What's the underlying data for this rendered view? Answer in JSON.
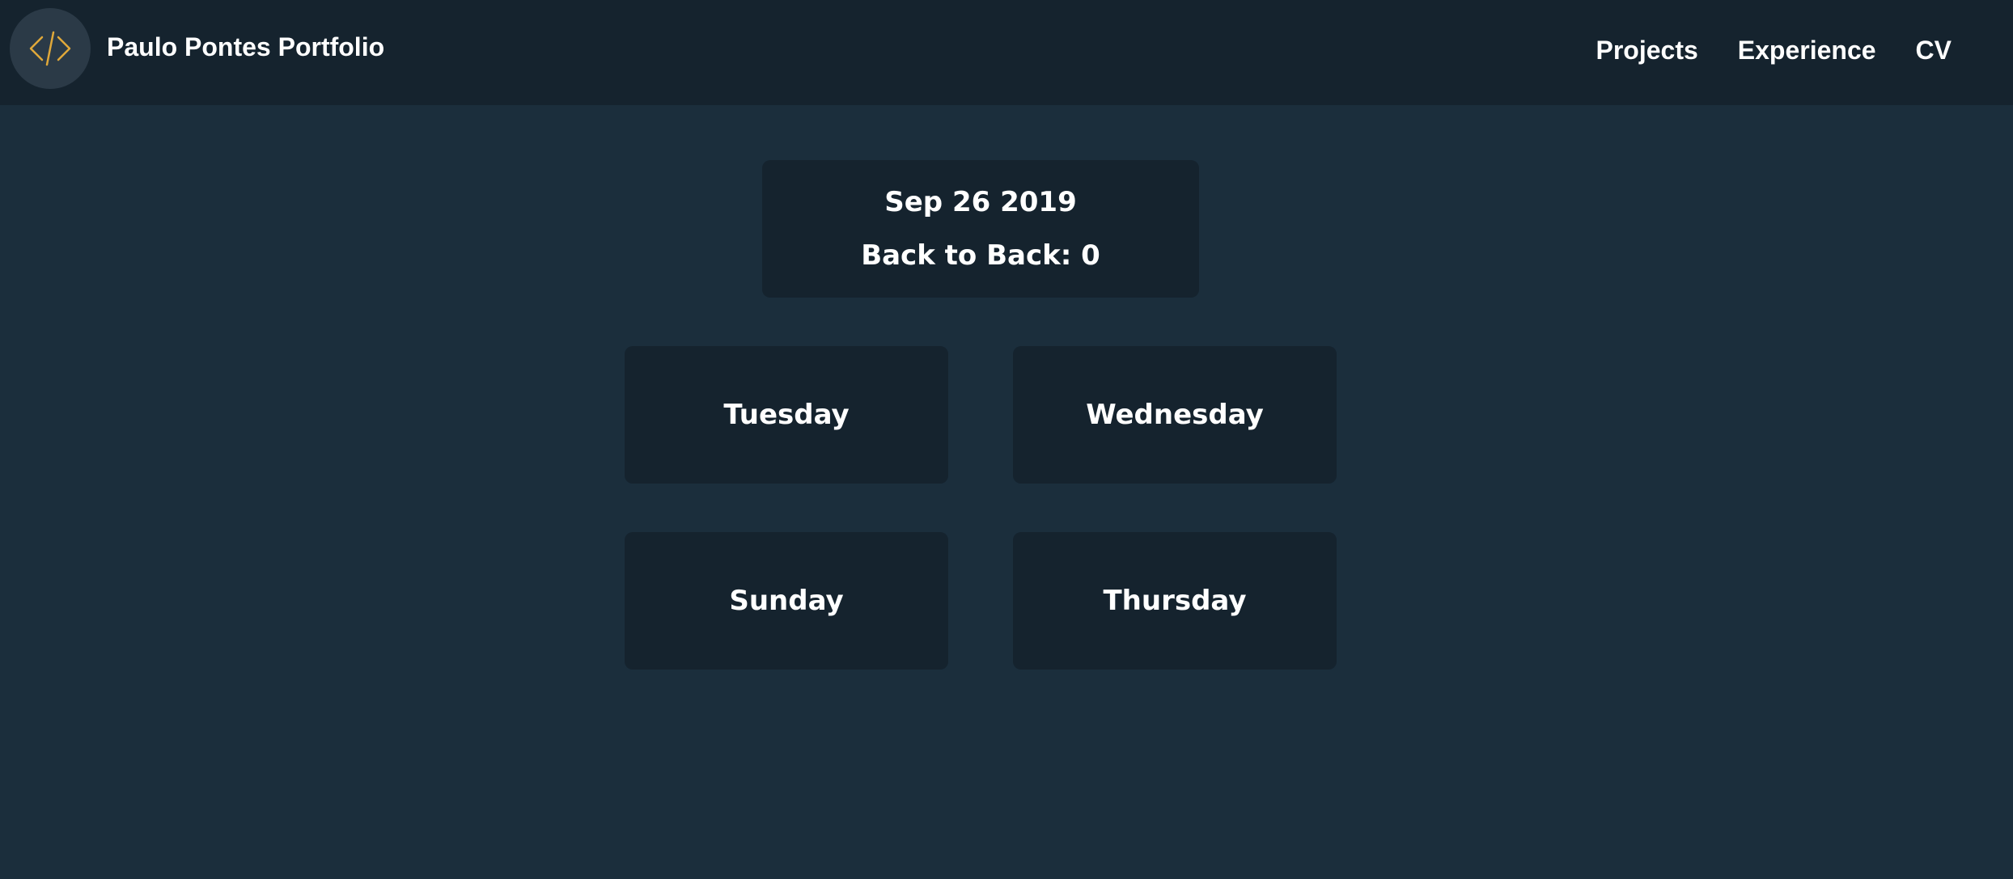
{
  "header": {
    "brand": "Paulo Pontes Portfolio",
    "logo_icon": "code-icon",
    "logo_color": "#e0a83a",
    "nav": [
      {
        "label": "Projects"
      },
      {
        "label": "Experience"
      },
      {
        "label": "CV"
      }
    ]
  },
  "info": {
    "date": "Sep 26 2019",
    "back_to_back": "Back to Back: 0"
  },
  "days": [
    {
      "label": "Tuesday"
    },
    {
      "label": "Wednesday"
    },
    {
      "label": "Sunday"
    },
    {
      "label": "Thursday"
    }
  ]
}
